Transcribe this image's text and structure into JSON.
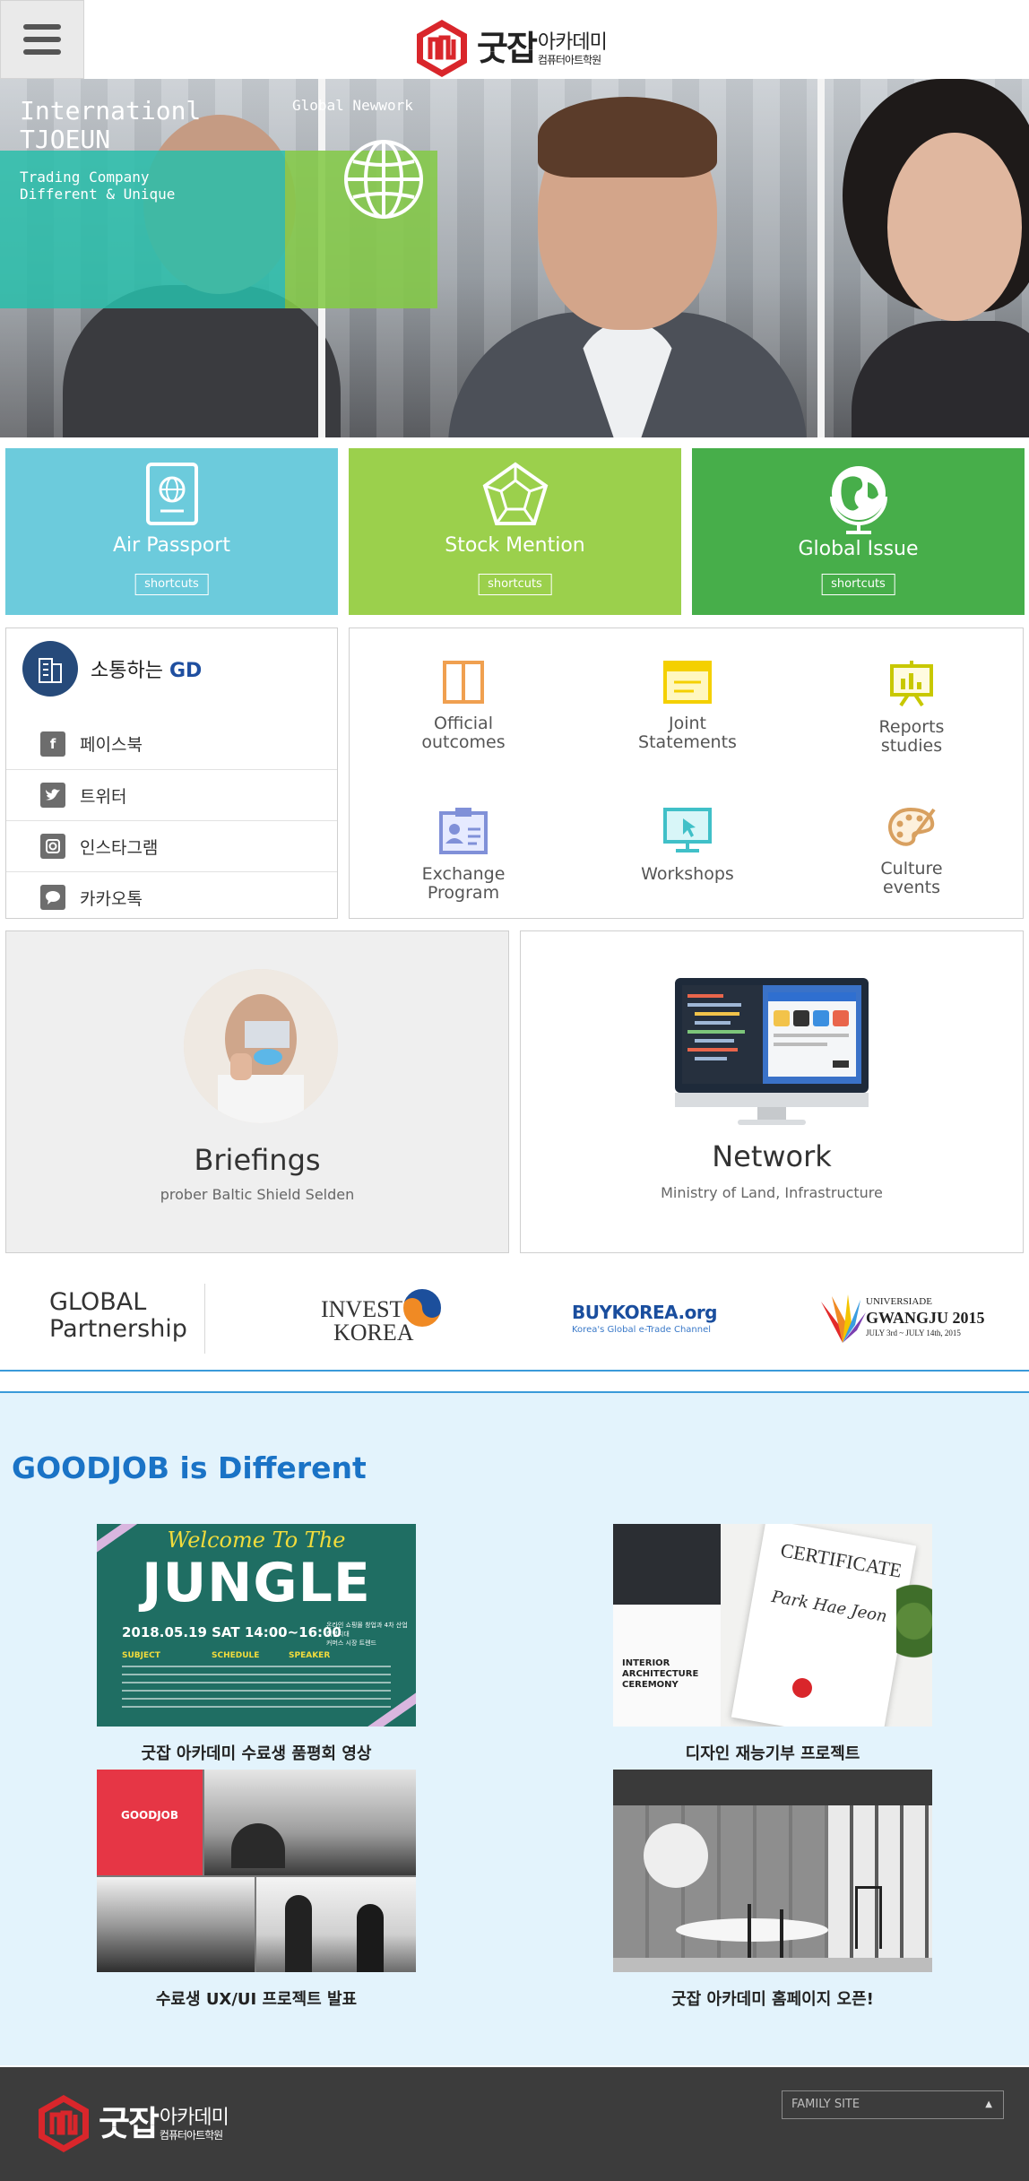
{
  "header": {
    "logo_main": "굿잡",
    "logo_sub1": "아카데미",
    "logo_sub2": "컴퓨터아트학원"
  },
  "hero": {
    "title_line1": "Internationl",
    "title_line2": "TJOEUN",
    "sub_line1": "Trading Company",
    "sub_line2": "Different & Unique",
    "side_label": "Global Newwork"
  },
  "tiles": [
    {
      "label": "Air Passport",
      "button": "shortcuts",
      "color": "#6ccbdc"
    },
    {
      "label": "Stock Mention",
      "button": "shortcuts",
      "color": "#9bd04c"
    },
    {
      "label": "Global Issue",
      "button": "shortcuts",
      "color": "#47ae4a"
    }
  ],
  "sns": {
    "title": "소통하는",
    "title_accent": "GD",
    "items": [
      {
        "label": "페이스북",
        "icon": "facebook-icon"
      },
      {
        "label": "트위터",
        "icon": "twitter-icon"
      },
      {
        "label": "인스타그램",
        "icon": "instagram-icon"
      },
      {
        "label": "카카오톡",
        "icon": "kakaotalk-icon"
      }
    ]
  },
  "categories": [
    {
      "line1": "Official",
      "line2": "outcomes",
      "icon": "panel-icon",
      "color": "#f0a050"
    },
    {
      "line1": "Joint",
      "line2": "Statements",
      "icon": "document-icon",
      "color": "#f4d000"
    },
    {
      "line1": "Reports",
      "line2": "studies",
      "icon": "presentation-icon",
      "color": "#c8c800"
    },
    {
      "line1": "Exchange",
      "line2": "Program",
      "icon": "id-card-icon",
      "color": "#8090d8"
    },
    {
      "line1": "Workshops",
      "line2": "",
      "icon": "monitor-icon",
      "color": "#40c0c8"
    },
    {
      "line1": "Culture",
      "line2": "events",
      "icon": "palette-icon",
      "color": "#d8a060"
    }
  ],
  "features": [
    {
      "title": "Briefings",
      "sub": "prober Baltic Shield Selden"
    },
    {
      "title": "Network",
      "sub": "Ministry of Land, Infrastructure"
    }
  ],
  "partner": {
    "label_line1": "GLOBAL",
    "label_line2": "Partnership",
    "invest_line1": "INVEST",
    "invest_line2": "KOREA",
    "buykorea": "BUYKOREA.org",
    "buykorea_sub": "Korea's Global e-Trade Channel",
    "universiade": "UNIVERSIADE",
    "gwangju": "GWANGJU 2015",
    "gwangju_dates": "JULY 3rd ~ JULY 14th, 2015"
  },
  "goodjob": {
    "title": "GOODJOB is Different",
    "items": [
      {
        "caption": "굿잡 아카데미 수료생 품평회 영상"
      },
      {
        "caption": "디자인 재능기부 프로젝트"
      },
      {
        "caption": "수료생 UX/UI 프로젝트 발표"
      },
      {
        "caption": "굿잡 아카데미 홈페이지 오픈!"
      }
    ],
    "jungle": {
      "welcome": "Welcome To The",
      "word": "JUNGLE",
      "date": "2018.05.19 SAT 14:00~16:00",
      "side": "온라인 쇼핑몰 창업과 4차 산업혁명시대",
      "side2": "커머스 시장 트렌드",
      "col1": "SUBJECT",
      "col2": "SCHEDULE",
      "col3": "SPEAKER"
    },
    "cert": {
      "title": "CERTIFICATE",
      "name": "Park Hae Jeon",
      "ceremony1": "INTERIOR",
      "ceremony2": "ARCHITECTURE",
      "ceremony3": "CEREMONY"
    },
    "ux": {
      "badge": "GOODJOB"
    }
  },
  "footer": {
    "logo_main": "굿잡",
    "logo_sub1": "아카데미",
    "logo_sub2": "컴퓨터아트학원",
    "family_site": "FAMILY SITE"
  }
}
